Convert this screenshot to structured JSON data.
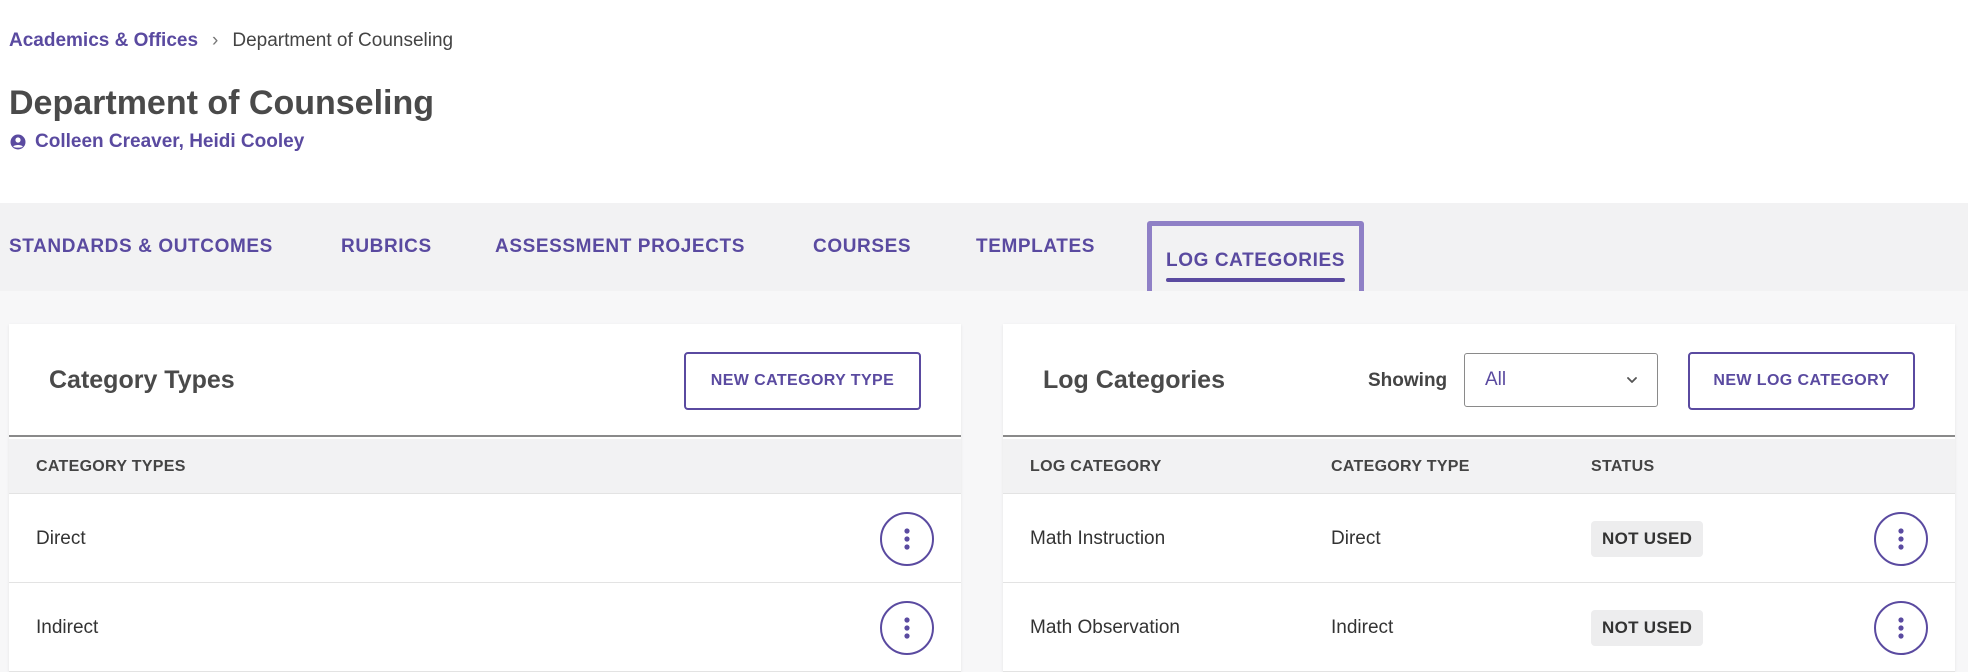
{
  "breadcrumb": {
    "parent": "Academics & Offices",
    "separator": "›",
    "current": "Department of Counseling"
  },
  "page": {
    "title": "Department of Counseling",
    "owners": "Colleen Creaver, Heidi Cooley",
    "owners_icon": "user-circle-icon"
  },
  "tabs": [
    {
      "label": "STANDARDS & OUTCOMES"
    },
    {
      "label": "RUBRICS"
    },
    {
      "label": "ASSESSMENT PROJECTS"
    },
    {
      "label": "COURSES"
    },
    {
      "label": "TEMPLATES"
    },
    {
      "label": "LOG CATEGORIES",
      "active": true
    }
  ],
  "category_types_panel": {
    "title": "Category Types",
    "new_button": "NEW CATEGORY TYPE",
    "columns": [
      "CATEGORY TYPES"
    ],
    "rows": [
      {
        "name": "Direct"
      },
      {
        "name": "Indirect"
      }
    ]
  },
  "log_categories_panel": {
    "title": "Log Categories",
    "showing_label": "Showing",
    "filter_value": "All",
    "new_button": "NEW LOG CATEGORY",
    "columns": [
      "LOG CATEGORY",
      "CATEGORY TYPE",
      "STATUS"
    ],
    "rows": [
      {
        "log_category": "Math Instruction",
        "category_type": "Direct",
        "status": "NOT USED"
      },
      {
        "log_category": "Math Observation",
        "category_type": "Indirect",
        "status": "NOT USED"
      }
    ]
  },
  "colors": {
    "accent": "#5a4aa0",
    "active_tab_outline": "#8f80c6",
    "tabbar_bg": "#f2f2f3"
  }
}
